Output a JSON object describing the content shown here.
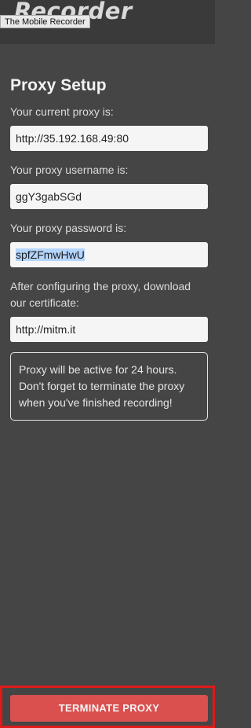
{
  "header": {
    "logo_text": "Recorder",
    "tooltip": "The Mobile Recorder"
  },
  "proxy_setup": {
    "title": "Proxy Setup",
    "proxy_label": "Your current proxy is:",
    "proxy_value": "http://35.192.168.49:80",
    "username_label": "Your proxy username is:",
    "username_value": "ggY3gabSGd",
    "password_label": "Your proxy password is:",
    "password_value": "spfZFmwHwU",
    "certificate_label": "After configuring the proxy, download our certificate:",
    "certificate_url": "http://mitm.it",
    "notice": "Proxy will be active for 24 hours. Don't forget to terminate the proxy when you've finished recording!"
  },
  "footer": {
    "terminate_label": "TERMINATE PROXY"
  },
  "colors": {
    "background": "#454545",
    "header": "#3a3a3a",
    "terminate_button": "#d9504f",
    "highlight_border": "#e01919",
    "selection": "#b4d5fe"
  }
}
